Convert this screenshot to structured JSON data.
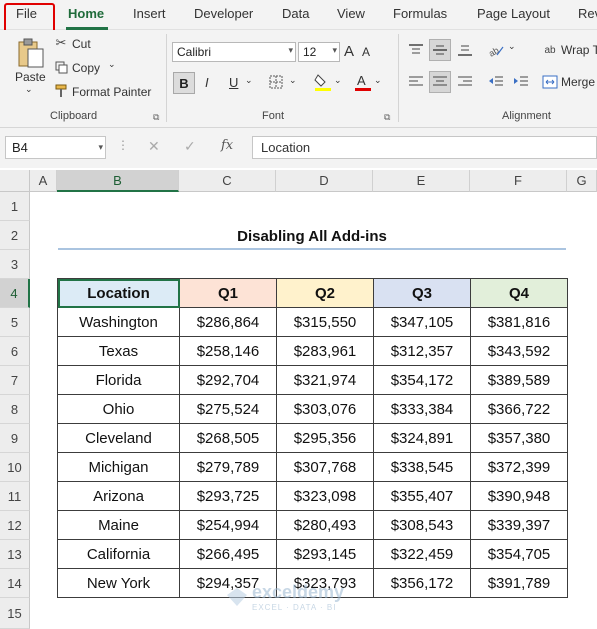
{
  "menu": {
    "tabs": [
      "File",
      "Home",
      "Insert",
      "Developer",
      "Data",
      "View",
      "Formulas",
      "Page Layout",
      "Rev"
    ],
    "active": "Home"
  },
  "ribbon": {
    "clipboard": {
      "paste": "Paste",
      "cut": "Cut",
      "copy": "Copy",
      "format_painter": "Format Painter",
      "label": "Clipboard"
    },
    "font": {
      "name": "Calibri",
      "size": "12",
      "grow": "A",
      "shrink": "A",
      "bold": "B",
      "italic": "I",
      "underline": "U",
      "label": "Font",
      "fill_color": "#ffff00",
      "font_color": "#e00000"
    },
    "alignment": {
      "wrap": "Wrap T",
      "merge": "Merge",
      "label": "Alignment"
    }
  },
  "formula_bar": {
    "name_box": "B4",
    "fx": "fx",
    "value": "Location"
  },
  "grid": {
    "columns": [
      "A",
      "B",
      "C",
      "D",
      "E",
      "F",
      "G"
    ],
    "rows": [
      "1",
      "2",
      "3",
      "4",
      "5",
      "6",
      "7",
      "8",
      "9",
      "10",
      "11",
      "12",
      "13",
      "14",
      "15"
    ],
    "selected_cell": "B4"
  },
  "sheet": {
    "title": "Disabling All Add-ins",
    "headers": [
      "Location",
      "Q1",
      "Q2",
      "Q3",
      "Q4"
    ],
    "header_colors": {
      "location": "#dcebf6",
      "q1": "#fde3d6",
      "q2": "#fff2cc",
      "q3": "#d9e1f2",
      "q4": "#e2efda"
    },
    "rows": [
      [
        "Washington",
        "$286,864",
        "$315,550",
        "$347,105",
        "$381,816"
      ],
      [
        "Texas",
        "$258,146",
        "$283,961",
        "$312,357",
        "$343,592"
      ],
      [
        "Florida",
        "$292,704",
        "$321,974",
        "$354,172",
        "$389,589"
      ],
      [
        "Ohio",
        "$275,524",
        "$303,076",
        "$333,384",
        "$366,722"
      ],
      [
        "Cleveland",
        "$268,505",
        "$295,356",
        "$324,891",
        "$357,380"
      ],
      [
        "Michigan",
        "$279,789",
        "$307,768",
        "$338,545",
        "$372,399"
      ],
      [
        "Arizona",
        "$293,725",
        "$323,098",
        "$355,407",
        "$390,948"
      ],
      [
        "Maine",
        "$254,994",
        "$280,493",
        "$308,543",
        "$339,397"
      ],
      [
        "California",
        "$266,495",
        "$293,145",
        "$322,459",
        "$354,705"
      ],
      [
        "New York",
        "$294,357",
        "$323,793",
        "$356,172",
        "$391,789"
      ]
    ]
  },
  "watermark": {
    "name": "exceldemy",
    "sub": "EXCEL · DATA · BI"
  }
}
